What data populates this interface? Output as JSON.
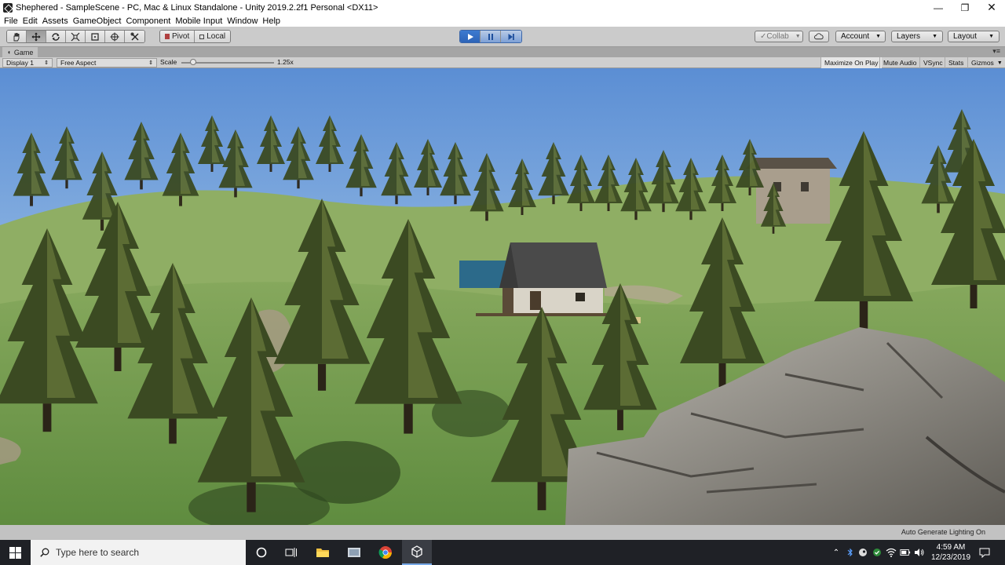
{
  "window": {
    "title": "Shephered - SampleScene - PC, Mac & Linux Standalone - Unity 2019.2.2f1 Personal <DX11>",
    "minimize": "—",
    "maximize": "❐",
    "close": "✕"
  },
  "menu": [
    "File",
    "Edit",
    "Assets",
    "GameObject",
    "Component",
    "Mobile Input",
    "Window",
    "Help"
  ],
  "toolbar": {
    "pivot_label": "Pivot",
    "local_label": "Local",
    "collab_label": "Collab",
    "account_label": "Account",
    "layers_label": "Layers",
    "layout_label": "Layout",
    "play_state": "playing"
  },
  "game_tab": {
    "label": "Game",
    "display": "Display 1",
    "aspect": "Free Aspect",
    "scale_label": "Scale",
    "scale_value": "1.25x",
    "maximize_on_play": "Maximize On Play",
    "mute_audio": "Mute Audio",
    "vsync": "VSync",
    "stats": "Stats",
    "gizmos": "Gizmos"
  },
  "status": {
    "lighting": "Auto Generate Lighting On"
  },
  "taskbar": {
    "search_placeholder": "Type here to search",
    "time": "4:59 AM",
    "date": "12/23/2019"
  },
  "colors": {
    "play_blue": "#2d64b8",
    "taskbar": "#1f2126",
    "sky_top": "#5c8fd6",
    "grass": "#6f9a4a"
  }
}
